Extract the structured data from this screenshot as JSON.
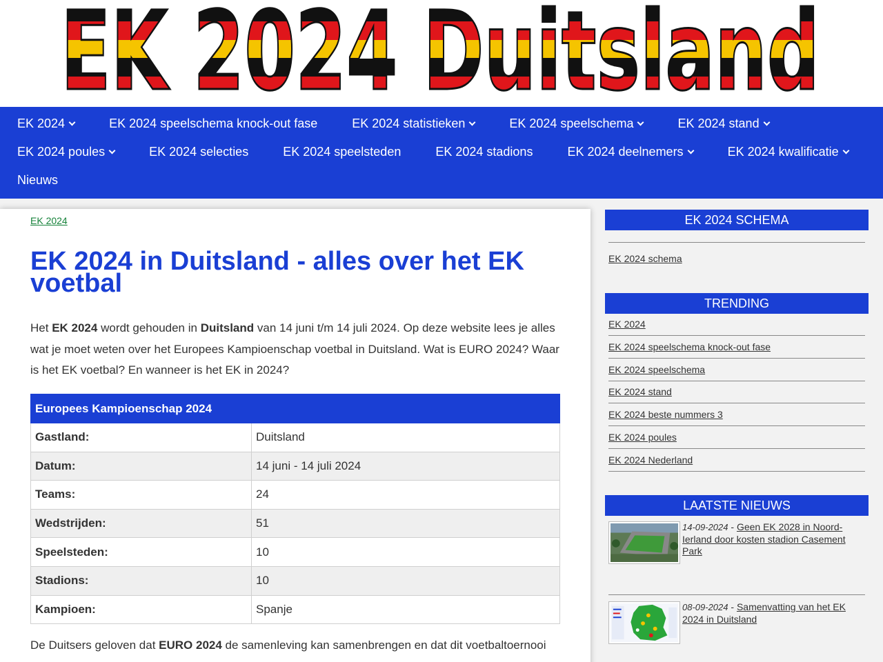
{
  "logo": {
    "text": "EK 2024 Duitsland"
  },
  "nav": {
    "row1": [
      {
        "label": "EK 2024",
        "dropdown": true
      },
      {
        "label": "EK 2024 speelschema knock-out fase",
        "dropdown": false
      },
      {
        "label": "EK 2024 statistieken",
        "dropdown": true
      },
      {
        "label": "EK 2024 speelschema",
        "dropdown": true
      },
      {
        "label": "EK 2024 stand",
        "dropdown": true
      }
    ],
    "row2": [
      {
        "label": "EK 2024 poules",
        "dropdown": true
      },
      {
        "label": "EK 2024 selecties",
        "dropdown": false
      },
      {
        "label": "EK 2024 speelsteden",
        "dropdown": false
      },
      {
        "label": "EK 2024 stadions",
        "dropdown": false
      },
      {
        "label": "EK 2024 deelnemers",
        "dropdown": true
      },
      {
        "label": "EK 2024 kwalificatie",
        "dropdown": true
      }
    ],
    "row3": [
      {
        "label": "Nieuws",
        "dropdown": false
      }
    ]
  },
  "main": {
    "breadcrumb": "EK 2024",
    "title": "EK 2024 in Duitsland - alles over het EK voetbal",
    "intro": {
      "p1": "Het ",
      "b1": "EK 2024",
      "p2": " wordt gehouden in ",
      "b2": "Duitsland",
      "p3": " van 14 juni t/m 14 juli 2024. Op deze website lees je alles wat je moet weten over het Europees Kampioenschap voetbal in Duitsland. Wat is EURO 2024? Waar is het EK voetbal? En wanneer is het EK in 2024?"
    },
    "table": {
      "header": "Europees Kampioenschap 2024",
      "rows": [
        {
          "label": "Gastland:",
          "value": "Duitsland"
        },
        {
          "label": "Datum:",
          "value": "14 juni - 14 juli 2024"
        },
        {
          "label": "Teams:",
          "value": "24"
        },
        {
          "label": "Wedstrijden:",
          "value": "51"
        },
        {
          "label": "Speelsteden:",
          "value": "10"
        },
        {
          "label": "Stadions:",
          "value": "10"
        },
        {
          "label": "Kampioen:",
          "value": "Spanje"
        }
      ]
    },
    "after": {
      "p1": "De Duitsers geloven dat ",
      "b1": "EURO 2024",
      "p2": " de samenleving kan samenbrengen en dat dit voetbaltoernooi"
    }
  },
  "sidebar": {
    "schema": {
      "title": "EK 2024 SCHEMA",
      "links": [
        "EK 2024 schema"
      ]
    },
    "trending": {
      "title": "TRENDING",
      "links": [
        "EK 2024",
        "EK 2024 speelschema knock-out fase",
        "EK 2024 speelschema",
        "EK 2024 stand",
        "EK 2024 beste nummers 3",
        "EK 2024 poules",
        "EK 2024 Nederland"
      ]
    },
    "news": {
      "title": "LAATSTE NIEUWS",
      "items": [
        {
          "date": "14-09-2024",
          "sep": " - ",
          "title": "Geen EK 2028 in Noord-Ierland door kosten stadion Casement Park"
        },
        {
          "date": "08-09-2024",
          "sep": " - ",
          "title": "Samenvatting van het EK 2024 in Duitsland"
        }
      ]
    }
  },
  "colors": {
    "brand_blue": "#1a3fd4",
    "breadcrumb_green": "#16823a"
  }
}
